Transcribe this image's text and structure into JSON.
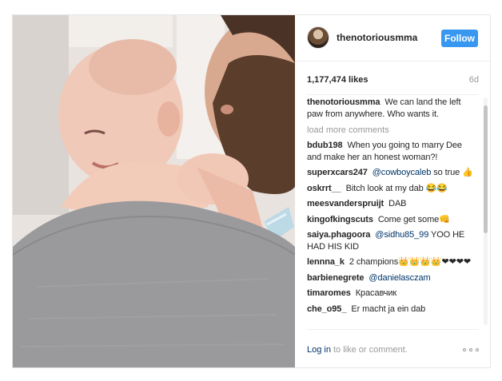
{
  "post": {
    "username": "thenotoriousmma",
    "follow_label": "Follow",
    "likes": "1,177,474 likes",
    "age": "6d",
    "caption": {
      "user": "thenotoriousmma",
      "text": "We can land the left paw from anywhere. Who wants it."
    },
    "load_more": "load more comments",
    "comments": [
      {
        "user": "bdub198",
        "text": "When you going to marry Dee and make her an honest woman?!",
        "mention": ""
      },
      {
        "user": "superxcars247",
        "mention": "@cowboycaleb",
        "text": "so true 👍"
      },
      {
        "user": "oskrrt__",
        "text": "Bitch look at my dab 😂😂",
        "mention": ""
      },
      {
        "user": "meesvanderspruijt",
        "text": "DAB",
        "mention": ""
      },
      {
        "user": "kingofkingscuts",
        "text": "Come get some👊",
        "mention": ""
      },
      {
        "user": "saiya.phagoora",
        "mention": "@sidhu85_99",
        "text": "YOO HE HAD HIS KID"
      },
      {
        "user": "lennna_k",
        "text": "2 champions👑👑👑👑❤❤❤❤",
        "mention": ""
      },
      {
        "user": "barbienegrete",
        "mention": "@danielasczam",
        "text": ""
      },
      {
        "user": "timaromes",
        "text": "Красавчик",
        "mention": ""
      },
      {
        "user": "che_o95_",
        "text": "Er macht ja ein dab",
        "mention": ""
      }
    ],
    "footer": {
      "login_link": "Log in",
      "login_text": "to like or comment."
    },
    "icons": {
      "more": "more-options-icon"
    },
    "colors": {
      "follow_bg": "#3897f0",
      "link": "#003569",
      "muted": "#999999"
    }
  }
}
